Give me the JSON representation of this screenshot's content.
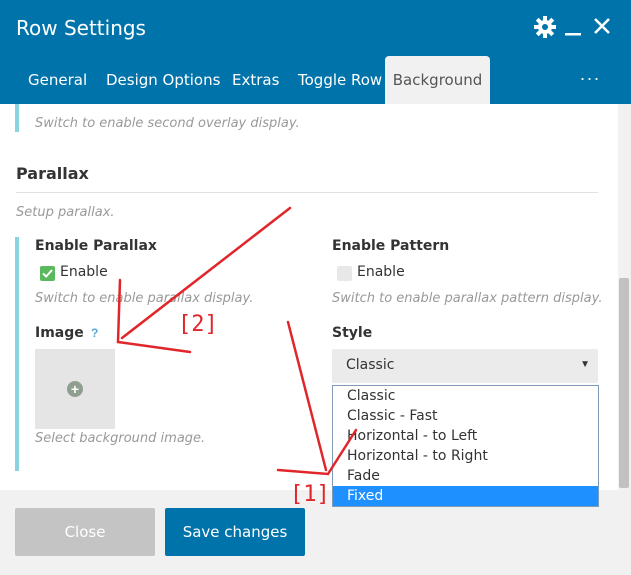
{
  "window": {
    "title": "Row Settings",
    "controls": [
      "gear-icon",
      "minimize-icon",
      "close-icon"
    ]
  },
  "tabs": [
    {
      "label": "General"
    },
    {
      "label": "Design Options"
    },
    {
      "label": "Extras"
    },
    {
      "label": "Toggle Row"
    },
    {
      "label": "Background",
      "active": true
    }
  ],
  "tabs_more": "...",
  "content": {
    "overlay_help": "Switch to enable second overlay display.",
    "section_title": "Parallax",
    "section_help": "Setup parallax.",
    "enable_parallax": {
      "label": "Enable Parallax",
      "checkbox_label": "Enable",
      "checked": true,
      "help": "Switch to enable parallax display."
    },
    "enable_pattern": {
      "label": "Enable Pattern",
      "checkbox_label": "Enable",
      "checked": false,
      "help": "Switch to enable parallax pattern display."
    },
    "image": {
      "label": "Image",
      "help_icon": "?",
      "help": "Select background image."
    },
    "style": {
      "label": "Style",
      "value": "Classic",
      "options": [
        "Classic",
        "Classic - Fast",
        "Horizontal - to Left",
        "Horizontal - to Right",
        "Fade",
        "Fixed"
      ],
      "highlighted": "Fixed"
    }
  },
  "footer": {
    "close_label": "Close",
    "save_label": "Save changes"
  },
  "annotations": {
    "marker_1": "[1]",
    "marker_2": "[2]"
  },
  "colors": {
    "header": "#0073aa",
    "accent_bar": "#8ad4e0",
    "annotation": "#e0262a",
    "highlight": "#1e90ff"
  }
}
